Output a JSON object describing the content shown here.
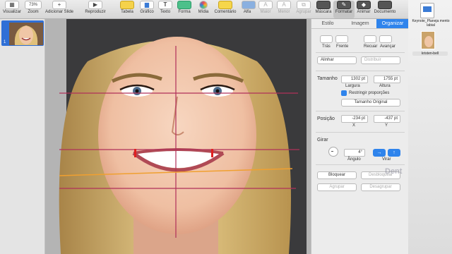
{
  "toolbar": {
    "items": [
      {
        "label": "Visualizar",
        "icon": "view-icon"
      },
      {
        "label": "Zoom",
        "value": "73%"
      },
      {
        "label": "Adicionar Slide",
        "icon": "plus-icon"
      },
      {
        "label": "Reproduzir",
        "icon": "play-icon"
      },
      {
        "label": "Tabela",
        "icon": "table-icon"
      },
      {
        "label": "Gráfico",
        "icon": "chart-icon"
      },
      {
        "label": "Texto",
        "icon": "text-icon"
      },
      {
        "label": "Forma",
        "icon": "shape-icon"
      },
      {
        "label": "Mídia",
        "icon": "media-icon"
      },
      {
        "label": "Comentário",
        "icon": "comment-icon"
      },
      {
        "label": "Alfa",
        "icon": "alpha-icon"
      },
      {
        "label": "Maior",
        "icon": "front-icon"
      },
      {
        "label": "Menor",
        "icon": "back-icon"
      },
      {
        "label": "Agrupar",
        "icon": "group-icon"
      },
      {
        "label": "Máscara",
        "icon": "mask-icon"
      },
      {
        "label": "Formatar",
        "icon": "format-icon"
      },
      {
        "label": "Animar",
        "icon": "animate-icon"
      },
      {
        "label": "Documento",
        "icon": "document-icon"
      }
    ]
  },
  "navigator": {
    "slide_number": "1"
  },
  "inspector": {
    "tabs": [
      "Estilo",
      "Imagem",
      "Organizar"
    ],
    "arrange_buttons": [
      "Trás",
      "Frente",
      "Recuar",
      "Avançar"
    ],
    "align_select": "Alinhar",
    "distribute_select": "Distribuir",
    "size_label": "Tamanho",
    "width_value": "1302 pt",
    "height_value": "1755 pt",
    "width_label": "Largura",
    "height_label": "Altura",
    "constrain_label": "Restringir proporções",
    "original_size_button": "Tamanho Original",
    "position_label": "Posição",
    "x_value": "-234 pt",
    "y_value": "-437 pt",
    "x_label": "X",
    "y_label": "Y",
    "rotate_label": "Girar",
    "angle_value": "4°",
    "angle_label": "Ângulo",
    "flip_label": "Virar",
    "lock_button": "Bloquear",
    "unlock_button": "Desbloquear",
    "group_button": "Agrupar",
    "ungroup_button": "Desagrupar"
  },
  "desktop": {
    "file1_name": "Keynote_Planeja mento labial",
    "file2_name": "kristen-bell"
  },
  "watermark": "Dent"
}
